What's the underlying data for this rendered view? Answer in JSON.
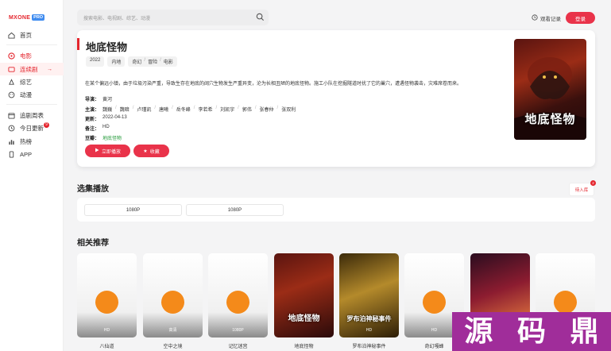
{
  "brand": {
    "name": "MXONE",
    "badge": "PRO",
    "accent": "#e4252d"
  },
  "sidebar": {
    "home": "首页",
    "movie": "电影",
    "series": "连续剧",
    "variety": "综艺",
    "anime": "动漫",
    "following": "追剧周表",
    "today": "今日更新",
    "today_badge": "9",
    "hot": "热榜",
    "app": "APP"
  },
  "header": {
    "search_placeholder": "搜索电影、电视剧、综艺、动漫",
    "history": "观看记录",
    "login": "登录"
  },
  "detail": {
    "title": "地底怪物",
    "year": "2022",
    "region": "内地",
    "genres": [
      "奇幻",
      "冒险",
      "电影"
    ],
    "description": "在某个偏远小镇，由于垃圾污染严重，导致生存在地底的阔穴生物发生严重异变，沦为长相丑陋的地底怪物。施工小队在挖掘隧道时扰了它的巢穴，遭遇怪物袭击，灾难席卷而来。",
    "director_label": "导演：",
    "director": "黄河",
    "cast_label": "主演：",
    "cast": [
      "魏巍",
      "魏暗",
      "卢瑾凯",
      "唐曦",
      "岳冬峰",
      "李若希",
      "刘凯宇",
      "郭伟",
      "张春仲",
      "张双利"
    ],
    "updated_label": "更新：",
    "updated": "2022-04-13",
    "note_label": "备注：",
    "note": "HD",
    "douban_label": "豆瓣：",
    "douban": "地底怪物",
    "play_button": "立即播放",
    "fav_button": "收藏",
    "poster_title": "地底怪物"
  },
  "episodes": {
    "title": "选集播放",
    "items": [
      "1080P",
      "1080P"
    ],
    "side_tab": "待入库",
    "side_tab_badge": "2"
  },
  "recommend": {
    "title": "相关推荐",
    "items": [
      {
        "name": "八仙道",
        "badge": "HD",
        "poster": ""
      },
      {
        "name": "空中之境",
        "badge": "高清",
        "poster": ""
      },
      {
        "name": "记忆迷宫",
        "badge": "1080P",
        "poster": ""
      },
      {
        "name": "地底怪物",
        "badge": "",
        "poster": "地底怪物"
      },
      {
        "name": "罗布泊神秘事件",
        "badge": "HD",
        "poster": "罗布泊神秘事件"
      },
      {
        "name": "奇幻嘎蜂",
        "badge": "HD",
        "poster": ""
      },
      {
        "name": "",
        "badge": "",
        "poster": ""
      },
      {
        "name": "",
        "badge": "",
        "poster": ""
      }
    ]
  },
  "watermark": [
    "源",
    "码",
    "鼎"
  ]
}
